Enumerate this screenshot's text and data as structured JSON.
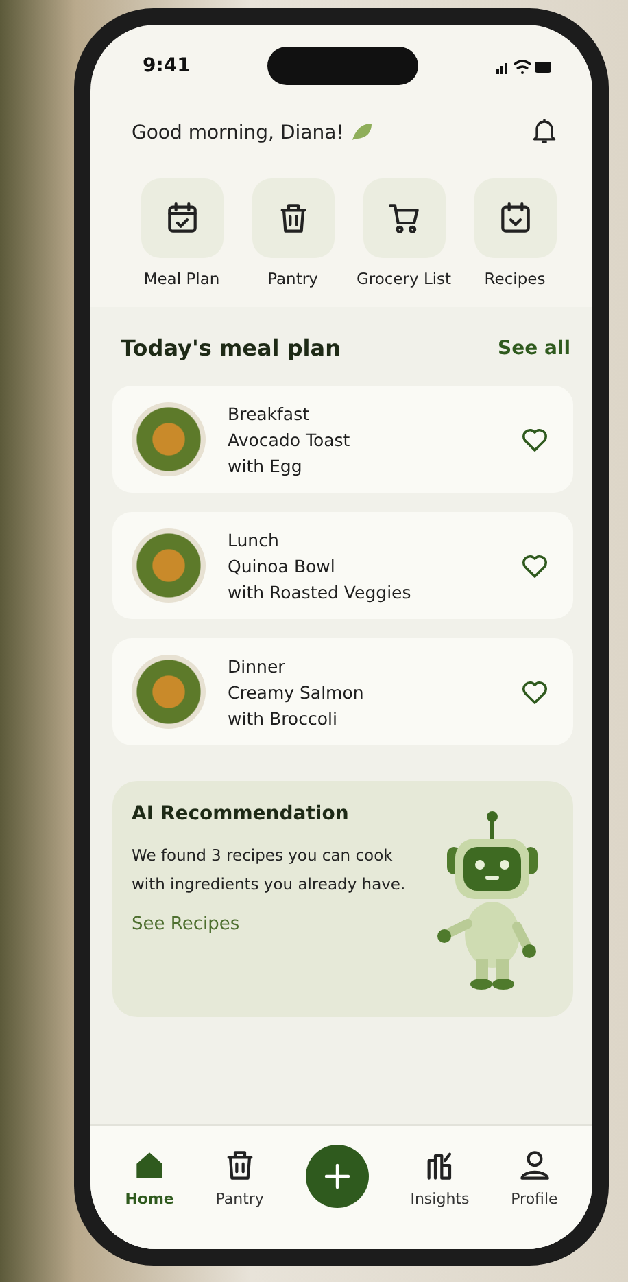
{
  "status_bar": {
    "time": "9:41"
  },
  "header": {
    "greeting": "Good morning, Diana!"
  },
  "quick_actions": [
    {
      "kind": "calendar",
      "label": "Meal Plan"
    },
    {
      "kind": "bin",
      "label": "Pantry"
    },
    {
      "kind": "cart",
      "label": "Grocery List"
    },
    {
      "kind": "recipe",
      "label": "Recipes"
    }
  ],
  "meal_plan": {
    "title": "Today's meal plan",
    "link": "See all",
    "meals": [
      {
        "meal": "Breakfast",
        "name": "Avocado Toast",
        "detail": "with Egg",
        "favorite": false
      },
      {
        "meal": "Lunch",
        "name": "Quinoa Bowl",
        "detail": "with Roasted Veggies",
        "favorite": false
      },
      {
        "meal": "Dinner",
        "name": "Creamy Salmon",
        "detail": "with Broccoli",
        "favorite": false
      }
    ]
  },
  "ai_recommendation": {
    "title": "AI Recommendation",
    "text": "We found 3 recipes you can cook with ingredients you already have.",
    "link": "See Recipes"
  },
  "bottom_nav": [
    {
      "kind": "home",
      "label": "Home",
      "selected": true
    },
    {
      "kind": "bin",
      "label": "Pantry",
      "selected": false
    },
    {
      "kind": "add"
    },
    {
      "kind": "insights",
      "label": "Insights",
      "selected": false
    },
    {
      "kind": "profile",
      "label": "Profile",
      "selected": false
    }
  ]
}
